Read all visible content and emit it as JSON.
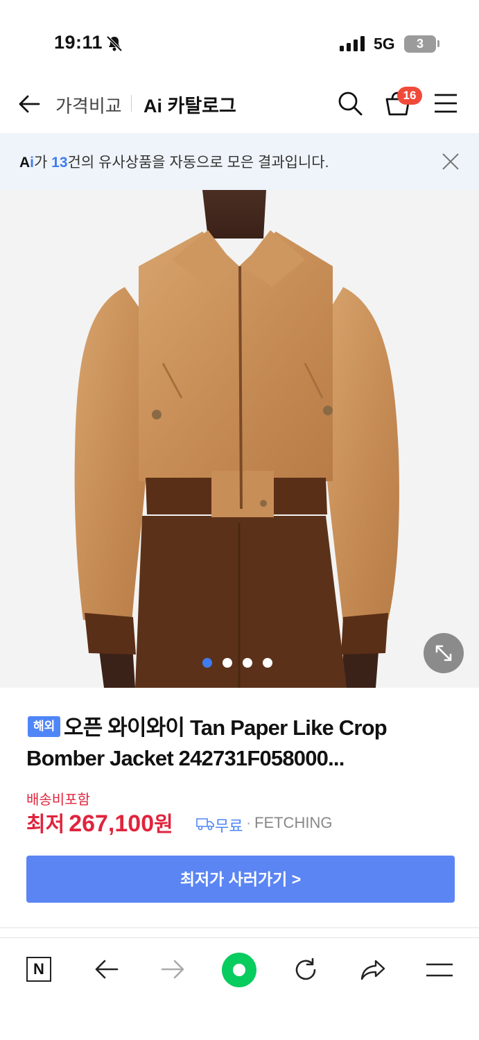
{
  "status_bar": {
    "time": "19:11",
    "network": "5G",
    "battery": "3"
  },
  "header": {
    "compare_label": "가격비교",
    "title": "Ai 카탈로그",
    "cart_count": "16"
  },
  "banner": {
    "ai_prefix": "A",
    "ai_i": "i",
    "text_before": "가 ",
    "count": "13",
    "text_after": "건의 유사상품을 자동으로 모은 결과입니다."
  },
  "gallery": {
    "total_dots": 4,
    "active_index": 0
  },
  "product": {
    "tag": "해외",
    "title": "오픈 와이와이 Tan Paper Like Crop Bomber Jacket 242731F058000...",
    "shipping_included": "배송비포함",
    "lowest_label": "최저",
    "price": "267,100",
    "currency": "원",
    "shipping_fee": "무료",
    "separator": "·",
    "shop": "FETCHING"
  },
  "cta": {
    "label": "최저가 사러가기 >"
  },
  "toolbar": {
    "n_label": "N"
  },
  "colors": {
    "accent": "#3f7cf0",
    "price_red": "#e0243d",
    "cta_blue": "#5b85f3",
    "naver_green": "#09cc5e"
  }
}
